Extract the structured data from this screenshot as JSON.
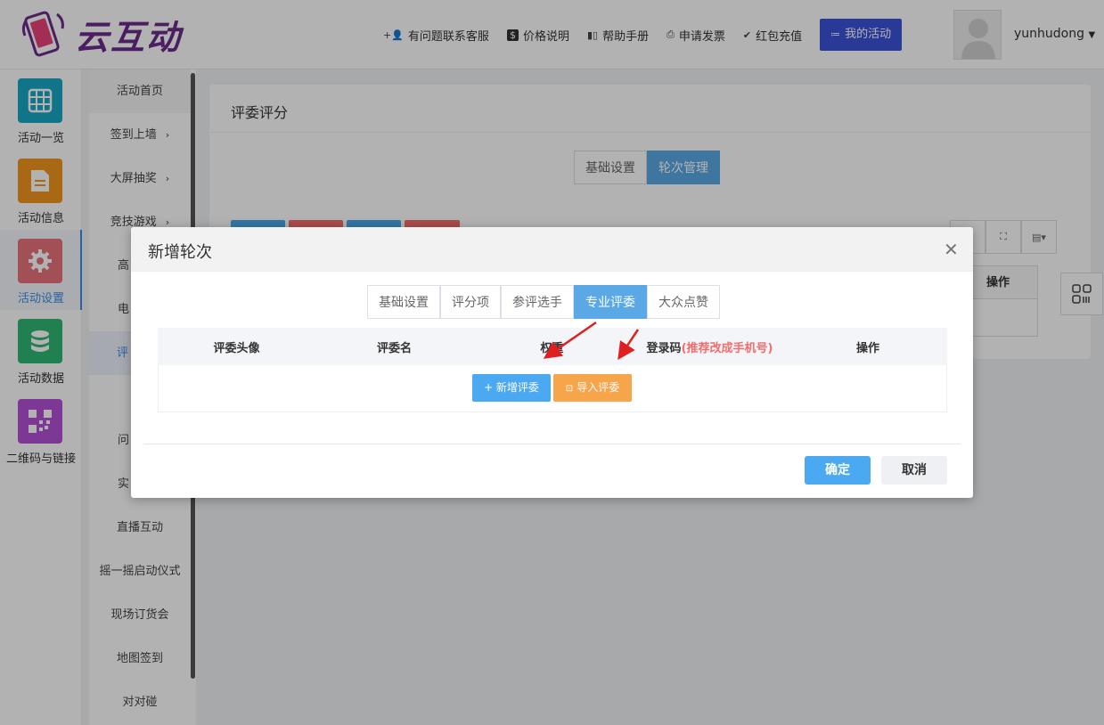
{
  "header": {
    "logo_text": "云互动",
    "nav": [
      {
        "icon": "add-user-icon",
        "label": "有问题联系客服"
      },
      {
        "icon": "dollar-icon",
        "label": "价格说明"
      },
      {
        "icon": "book-icon",
        "label": "帮助手册"
      },
      {
        "icon": "printer-icon",
        "label": "申请发票"
      },
      {
        "icon": "shield-check-icon",
        "label": "红包充值"
      }
    ],
    "my_activity": "我的活动",
    "username": "yunhudong"
  },
  "iconbar": [
    {
      "label": "活动一览",
      "icon": "grid-icon",
      "color": "#17a8c4"
    },
    {
      "label": "活动信息",
      "icon": "document-icon",
      "color": "#f2961c"
    },
    {
      "label": "活动设置",
      "icon": "gear-icon",
      "color": "#e8737b",
      "active": true
    },
    {
      "label": "活动数据",
      "icon": "database-icon",
      "color": "#2eb872"
    },
    {
      "label": "二维码与链接",
      "icon": "qrcode-icon",
      "color": "#b351d6"
    }
  ],
  "submenu": [
    {
      "label": "活动首页"
    },
    {
      "label": "签到上墙",
      "arrow": "›"
    },
    {
      "label": "大屏抽奖",
      "arrow": "›"
    },
    {
      "label": "竞技游戏",
      "arrow": "›"
    },
    {
      "label": "高"
    },
    {
      "label": "电"
    },
    {
      "label": "评"
    },
    {
      "label": ""
    },
    {
      "label": "问"
    },
    {
      "label": "实"
    },
    {
      "label": "直播互动"
    },
    {
      "label": "摇一摇启动仪式"
    },
    {
      "label": "现场订货会"
    },
    {
      "label": "地图签到"
    },
    {
      "label": "对对碰"
    }
  ],
  "panel": {
    "title": "评委评分",
    "tabs": [
      "基础设置",
      "轮次管理"
    ],
    "table_header": "操作",
    "buttons": [
      {
        "color": "#4aa9f1"
      },
      {
        "color": "#f56c6c"
      },
      {
        "color": "#4aa9f1"
      },
      {
        "color": "#f56c6c"
      }
    ]
  },
  "modal": {
    "title": "新增轮次",
    "tabs": [
      "基础设置",
      "评分项",
      "参评选手",
      "专业评委",
      "大众点赞"
    ],
    "active_tab": 3,
    "columns": [
      "评委头像",
      "评委名",
      "权重",
      "登录码",
      "操作"
    ],
    "login_hint": "(推荐改成手机号)",
    "add_judge": "+ 新增评委",
    "import_judge": "导入评委",
    "confirm": "确定",
    "cancel": "取消"
  }
}
